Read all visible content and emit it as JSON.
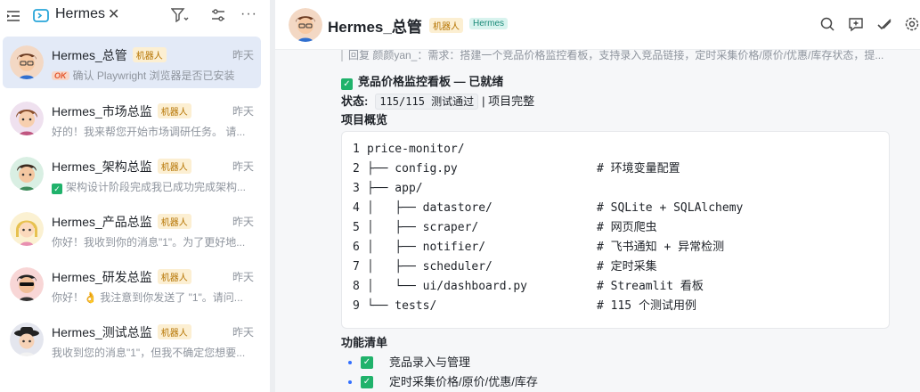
{
  "sidebar": {
    "title": "Hermes",
    "close_glyph": "✕",
    "more_glyph": "···",
    "icons": [
      "sidebar-collapse-icon",
      "agent-icon",
      "filter-icon",
      "adjust-icon",
      "more-icon"
    ],
    "conversations": [
      {
        "name": "Hermes_总管",
        "tag": "机器人",
        "time": "昨天",
        "badge": "OK",
        "preview": "确认 Playwright 浏览器是否已安装",
        "active": true
      },
      {
        "name": "Hermes_市场总监",
        "tag": "机器人",
        "time": "昨天",
        "preview": "好的！我来帮您开始市场调研任务。 请..."
      },
      {
        "name": "Hermes_架构总监",
        "tag": "机器人",
        "time": "昨天",
        "preview": "架构设计阶段完成我已成功完成架构..."
      },
      {
        "name": "Hermes_产品总监",
        "tag": "机器人",
        "time": "昨天",
        "preview": "你好！我收到你的消息\"1\"。为了更好地..."
      },
      {
        "name": "Hermes_研发总监",
        "tag": "机器人",
        "time": "昨天",
        "preview": "你好！👌 我注意到你发送了 \"1\"。请问..."
      },
      {
        "name": "Hermes_测试总监",
        "tag": "机器人",
        "time": "昨天",
        "preview": "我收到您的消息\"1\"，但我不确定您想要..."
      }
    ]
  },
  "chat": {
    "name": "Hermes_总管",
    "tag_bot": "机器人",
    "tag_hermes": "Hermes",
    "header_icons": [
      "search-icon",
      "add-chat-icon",
      "check-icon",
      "settings-icon"
    ],
    "quote": "回复 颜颜yan_：需求：搭建一个竞品价格监控看板，支持录入竞品链接，定时采集价格/原价/优惠/库存状态，提...",
    "heading": "竞品价格监控看板 — 已就绪",
    "status_label": "状态:",
    "status_code": "115/115 测试通过",
    "status_rest": "| 项目完整",
    "overview_title": "项目概览",
    "code_lines": [
      {
        "n": "1",
        "text": "price-monitor/",
        "comment": ""
      },
      {
        "n": "2",
        "text": "├── config.py",
        "comment": "# 环境变量配置"
      },
      {
        "n": "3",
        "text": "├── app/",
        "comment": ""
      },
      {
        "n": "4",
        "text": "│   ├── datastore/",
        "comment": "# SQLite + SQLAlchemy"
      },
      {
        "n": "5",
        "text": "│   ├── scraper/",
        "comment": "# 网页爬虫"
      },
      {
        "n": "6",
        "text": "│   ├── notifier/",
        "comment": "# 飞书通知 + 异常检测"
      },
      {
        "n": "7",
        "text": "│   ├── scheduler/",
        "comment": "# 定时采集"
      },
      {
        "n": "8",
        "text": "│   └── ui/dashboard.py",
        "comment": "# Streamlit 看板"
      },
      {
        "n": "9",
        "text": "└── tests/",
        "comment": "# 115 个测试用例"
      }
    ],
    "features_title": "功能清单",
    "features": [
      "竞品录入与管理",
      "定时采集价格/原价/优惠/库存"
    ]
  },
  "colors": {
    "active_item": "#e3eaf7",
    "check_green": "#20b26b",
    "bot_tag_bg": "#fcefd2",
    "bot_tag_text": "#b57300",
    "hermes_tag_bg": "#d8f3ee",
    "hermes_tag_text": "#1a8a78"
  }
}
